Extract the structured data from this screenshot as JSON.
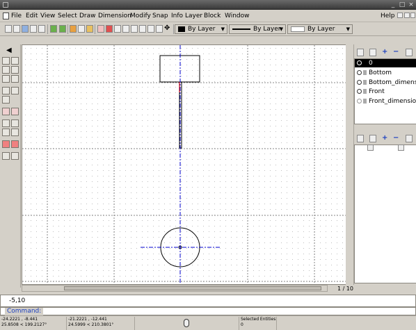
{
  "menubar": {
    "items": [
      "File",
      "Edit",
      "View",
      "Select",
      "Draw",
      "Dimension",
      "Modify",
      "Snap",
      "Info",
      "Layer",
      "Block",
      "Window"
    ],
    "help": "Help"
  },
  "toolbar": {
    "color_select": "By Layer",
    "linetype_select": "By Layer",
    "width_select": "By Layer"
  },
  "layers": {
    "items": [
      "0",
      "Bottom",
      "Bottom_dimension",
      "Front",
      "Front_dimension"
    ],
    "selected": "0"
  },
  "canvas": {
    "page_count": "1 / 10"
  },
  "command": {
    "history_line": "-5,10",
    "prompt_label": "Command:"
  },
  "status": {
    "abs_coord_1": "-24.2221 , -8.441",
    "abs_coord_2": "25.8508 < 199.2127°",
    "rel_coord_1": "-21.2221 , -12.441",
    "rel_coord_2": "24.5999 < 210.3801°",
    "selected_label": "Selected Entities:",
    "selected_count": "0"
  },
  "colors": {
    "accent_blue": "#1b3fbf",
    "axis_blue": "#0000cc",
    "highlight_red": "#cc0000"
  }
}
